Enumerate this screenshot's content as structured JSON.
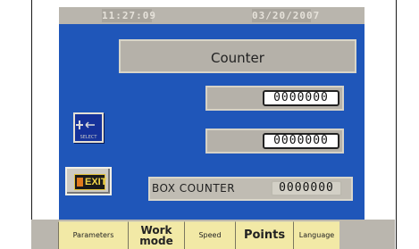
{
  "status_bar": {
    "time": "11:27:09",
    "date": "03/20/2007"
  },
  "title": "Counter",
  "counters": {
    "counter_1": "0000000",
    "counter_2": "0000000"
  },
  "box_counter": {
    "label": "BOX  COUNTER",
    "value": "0000000"
  },
  "buttons": {
    "select_label": "SELECT",
    "exit_label": "EXIT"
  },
  "tabs": [
    {
      "label": "Parameters"
    },
    {
      "label": "Work mode"
    },
    {
      "label": "Speed"
    },
    {
      "label": "Points"
    },
    {
      "label": "Language"
    }
  ],
  "colors": {
    "screen_bg": "#1f56b9",
    "lcd_gray": "#b5b1a9",
    "tab_yellow": "#f2e9a6",
    "exit_yellow": "#f5d84a"
  }
}
